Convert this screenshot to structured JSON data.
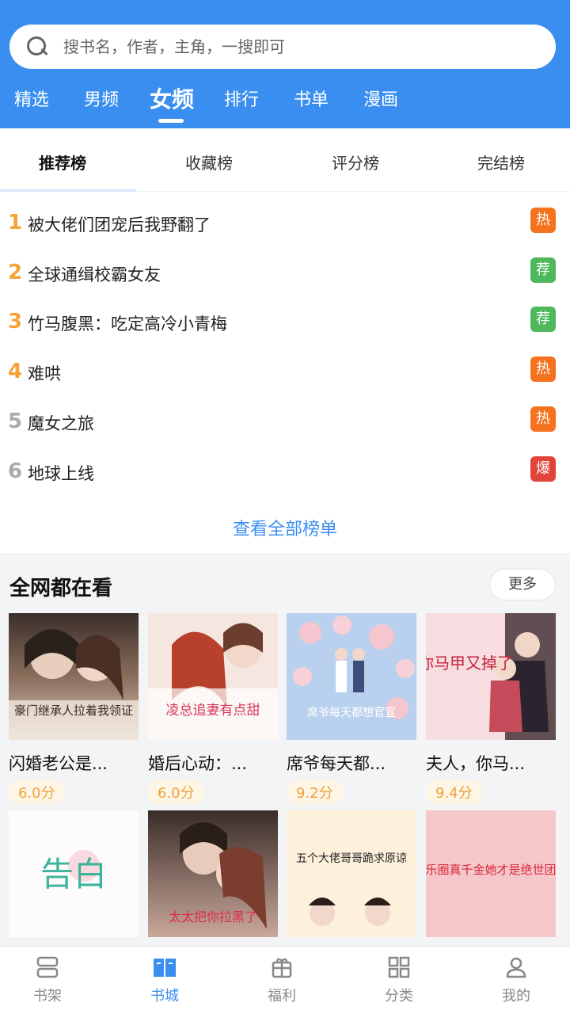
{
  "search": {
    "placeholder": "搜书名，作者，主角，一搜即可"
  },
  "top_tabs": [
    {
      "label": "精选",
      "active": false
    },
    {
      "label": "男频",
      "active": false
    },
    {
      "label": "女频",
      "active": true
    },
    {
      "label": "排行",
      "active": false
    },
    {
      "label": "书单",
      "active": false
    },
    {
      "label": "漫画",
      "active": false
    }
  ],
  "rank_tabs": [
    {
      "label": "推荐榜",
      "active": true
    },
    {
      "label": "收藏榜",
      "active": false
    },
    {
      "label": "评分榜",
      "active": false
    },
    {
      "label": "完结榜",
      "active": false
    }
  ],
  "rank_list": [
    {
      "num": "1",
      "title": "被大佬们团宠后我野翻了",
      "badge": "热",
      "badge_color": "#f5731f",
      "num_color": "#f5a335"
    },
    {
      "num": "2",
      "title": "全球通缉校霸女友",
      "badge": "荐",
      "badge_color": "#4fb85c",
      "num_color": "#f5a335"
    },
    {
      "num": "3",
      "title": "竹马腹黑：吃定高冷小青梅",
      "badge": "荐",
      "badge_color": "#4fb85c",
      "num_color": "#f5a335"
    },
    {
      "num": "4",
      "title": "难哄",
      "badge": "热",
      "badge_color": "#f5731f",
      "num_color": "#f5a335"
    },
    {
      "num": "5",
      "title": "魔女之旅",
      "badge": "热",
      "badge_color": "#f5731f",
      "num_color": "#aaaaaa"
    },
    {
      "num": "6",
      "title": "地球上线",
      "badge": "爆",
      "badge_color": "#e0443a",
      "num_color": "#aaaaaa"
    }
  ],
  "view_all": "查看全部榜单",
  "popular": {
    "title": "全网都在看",
    "more": "更多",
    "books": [
      {
        "name": "闪婚老公是...",
        "score": "6.0分",
        "cover_text": "豪门继承人拉着我领证"
      },
      {
        "name": "婚后心动：...",
        "score": "6.0分",
        "cover_text": "凌总追妻有点甜"
      },
      {
        "name": "席爷每天都...",
        "score": "9.2分",
        "cover_text": "席爷每天都想官宣"
      },
      {
        "name": "夫人，你马...",
        "score": "9.4分",
        "cover_text": "你马甲又掉了"
      },
      {
        "name": "",
        "score": "",
        "cover_text": "告白"
      },
      {
        "name": "",
        "score": "",
        "cover_text": "太太把你拉黑了"
      },
      {
        "name": "",
        "score": "",
        "cover_text": "五个大佬哥哥跪求原谅"
      },
      {
        "name": "",
        "score": "",
        "cover_text": "娱乐圈真千金她才是绝世团宠"
      }
    ]
  },
  "bottom_nav": [
    {
      "label": "书架",
      "icon": "bookshelf-icon",
      "active": false
    },
    {
      "label": "书城",
      "icon": "book-city-icon",
      "active": true
    },
    {
      "label": "福利",
      "icon": "gift-icon",
      "active": false
    },
    {
      "label": "分类",
      "icon": "grid-icon",
      "active": false
    },
    {
      "label": "我的",
      "icon": "person-icon",
      "active": false
    }
  ],
  "colors": {
    "primary": "#3a8ef0",
    "hot": "#f5731f",
    "recommend": "#4fb85c",
    "boom": "#e0443a",
    "score": "#f0a03a"
  }
}
